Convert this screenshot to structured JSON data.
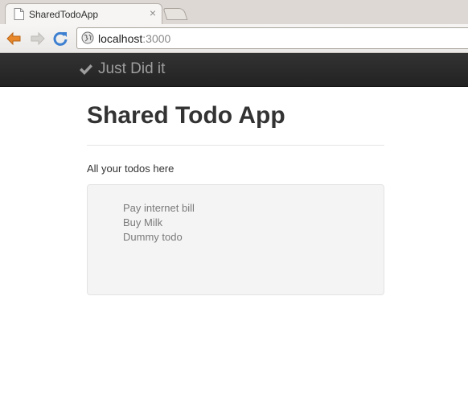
{
  "browser": {
    "tab": {
      "title": "SharedTodoApp"
    },
    "address_bar": {
      "host": "localhost",
      "port": ":3000"
    }
  },
  "navbar": {
    "brand": "Just Did it"
  },
  "main": {
    "title": "Shared Todo App",
    "subtitle": "All your todos here",
    "todos": [
      "Pay internet bill",
      "Buy Milk",
      "Dummy todo"
    ]
  },
  "colors": {
    "navbar_bg": "#222222",
    "brand_text": "#9d9d9d",
    "well_bg": "#f4f4f4",
    "todo_text": "#7a7a7a"
  }
}
